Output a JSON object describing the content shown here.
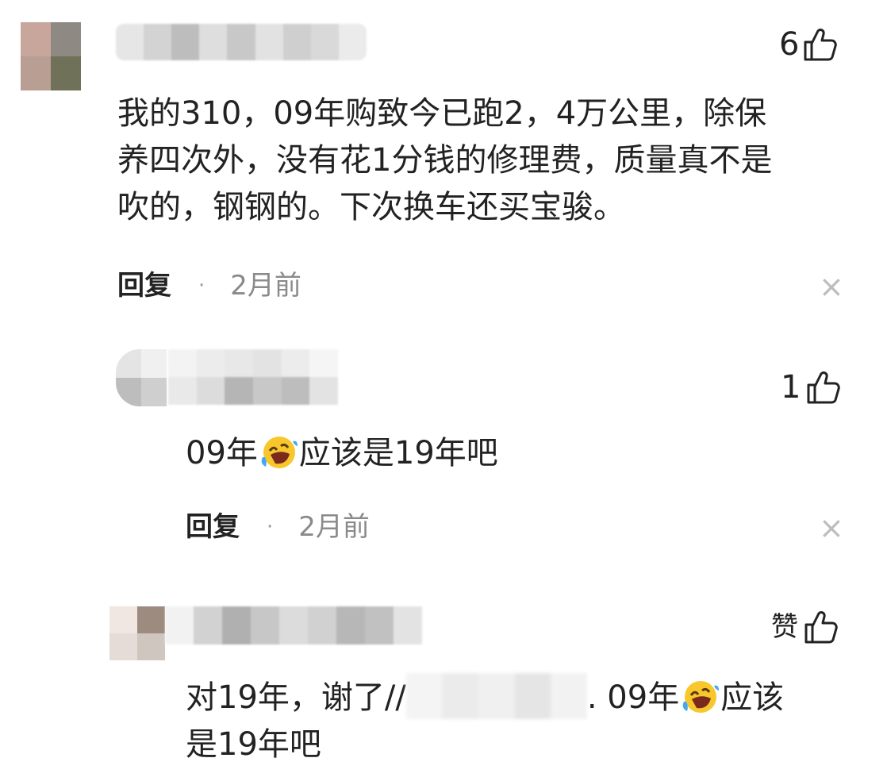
{
  "comments": [
    {
      "likes": "6",
      "text_lines": [
        "我的310，09年购致今已跑2，4万公里，除保",
        "养四次外，没有花1分钱的修理费，质量真不是",
        "吹的，钢钢的。下次换车还买宝骏。"
      ],
      "reply_label": "回复",
      "separator": "·",
      "time": "2月前",
      "close_symbol": "×"
    },
    {
      "likes": "1",
      "text_before_emoji": "09年",
      "emoji": "rolling-laughing-emoji",
      "text_after_emoji": "应该是19年吧",
      "reply_label": "回复",
      "separator": "·",
      "time": "2月前",
      "close_symbol": "×"
    },
    {
      "likes_label": "赞",
      "line1_start": "对19年，谢了//",
      "line1_after_blur": ". 09年",
      "emoji": "rolling-laughing-emoji",
      "line1_end": "应该",
      "line2": "是19年吧"
    }
  ],
  "icons": {
    "like": "thumbs-up-icon",
    "close": "close-icon"
  },
  "colors": {
    "text": "#222222",
    "muted": "#8a8a8a",
    "close": "#bdbdbd",
    "emoji_face": "#f8c72c",
    "emoji_tears": "#3fa9f5"
  }
}
